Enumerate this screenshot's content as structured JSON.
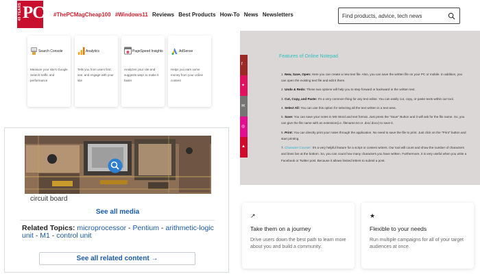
{
  "header": {
    "logo": {
      "side_text": "40 YEARS",
      "brand": "PC"
    },
    "nav": [
      {
        "label": "#ThePCMagCheap100",
        "style": "hot"
      },
      {
        "label": "#Windows11",
        "style": "hot"
      },
      {
        "label": "Reviews",
        "style": "plain"
      },
      {
        "label": "Best Products",
        "style": "plain"
      },
      {
        "label": "How-To",
        "style": "plain"
      },
      {
        "label": "News",
        "style": "plain"
      },
      {
        "label": "Newsletters",
        "style": "plain"
      }
    ],
    "search": {
      "placeholder": "Find products, advice, tech news",
      "icon": "search-icon"
    }
  },
  "tools": [
    {
      "title": "Search Console",
      "desc": "Measure your site's Google Search traffic and performance",
      "icon": "search-console-icon",
      "color": "#e1a43a"
    },
    {
      "title": "Analytics",
      "desc": "Tells you from users first, see, and engage with your site",
      "icon": "analytics-icon",
      "color": "#f5a623"
    },
    {
      "title": "PageSpeed Insights",
      "desc": "Analyzes your site and suggests ways to make it faster",
      "icon": "pagespeed-icon",
      "color": "#e34b6b"
    },
    {
      "title": "AdSense",
      "desc": "Helps you earn some money from your online content",
      "icon": "adsense-icon",
      "color": "#4285f4"
    }
  ],
  "encyclopedia": {
    "caption": "circuit board",
    "see_all_media": "See all media",
    "related_label": "Related Topics:",
    "related_topics": [
      "microprocessor",
      "Pentium",
      "arithmetic-logic unit",
      "M1",
      "control unit"
    ],
    "see_all_related": "See all related content →"
  },
  "notepad": {
    "title": "Features of Online Notepad",
    "features": [
      {
        "term": "New, Save, Open:",
        "text": " Here you can create a new text file. Also, you can save the written file on your PC or mobile. In addition, you can open the existing text file and edit it there."
      },
      {
        "term": "Undo & Redo:",
        "text": " These two options will help you to step forward or backward in the written text."
      },
      {
        "term": "Cut, Copy, and Paste:",
        "text": " It's a very common thing for any text editor. You can easily cut, copy, or paste texts within our tool."
      },
      {
        "term": "Select All:",
        "text": " You can use this option for selecting all the text written in a text area."
      },
      {
        "term": "Save:",
        "text": " You can save your notes in MS Word and text format. Just press the \"Save\" Button and it will ask for the file name. So, you can give the file name with an extension(i.e. filename.txt or .doc/.docx) to save it."
      },
      {
        "term": "Print:",
        "text": " You can directly print your notes through the application. No need to save the file to print. Just click on the \"Print\" button and start printing."
      },
      {
        "term": "Character Counter:",
        "text": " It's a very helpful feature for a script or content writers. Our tool will count and show the number of characters and lines live at the bottom. So, you can count how many characters you have written. Furthermore, it is very useful when you write a Facebook or Twitter post. Because it allows limited letters to submit a post.",
        "link": true
      }
    ],
    "share": [
      {
        "icon": "facebook-icon",
        "glyph": "f",
        "color": "#9b2a27"
      },
      {
        "icon": "twitter-icon",
        "glyph": "✦",
        "color": "#e0115f"
      },
      {
        "icon": "email-icon",
        "glyph": "✉",
        "color": "#757575"
      },
      {
        "icon": "instagram-icon",
        "glyph": "◎",
        "color": "#e0118f"
      },
      {
        "icon": "pinterest-icon",
        "glyph": "▲",
        "color": "#d10b2d"
      }
    ]
  },
  "features": [
    {
      "icon": "trend-icon",
      "glyph": "↗",
      "title": "Take them on a journey",
      "desc": "Drive users down the best path to learn more about you and build a community."
    },
    {
      "icon": "star-icon",
      "glyph": "★",
      "title": "Flexible to your needs",
      "desc": "Run multiple campaigns for all of your target audiences at once."
    }
  ]
}
